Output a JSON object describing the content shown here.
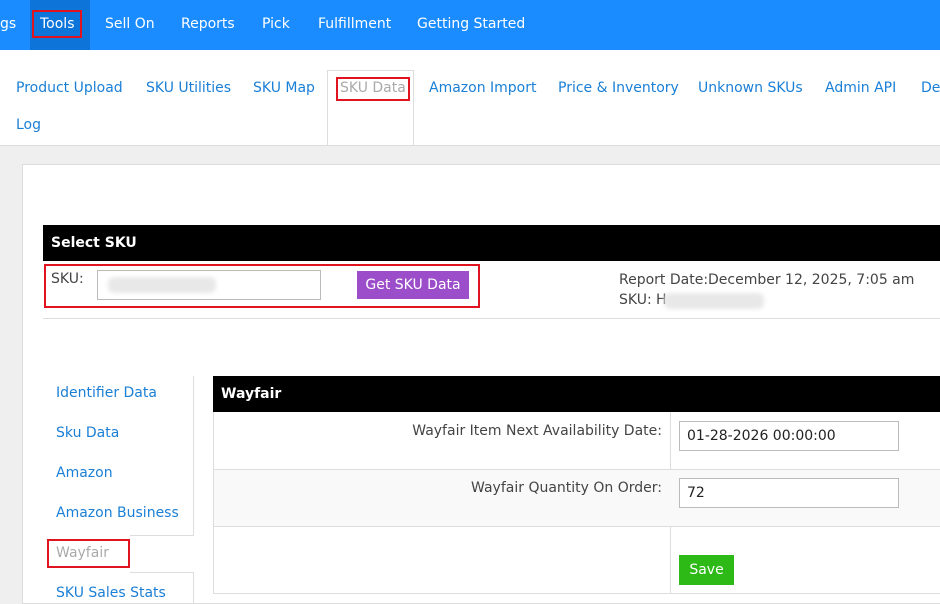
{
  "topnav": {
    "items": [
      {
        "label": "gs"
      },
      {
        "label": "Tools"
      },
      {
        "label": "Sell On"
      },
      {
        "label": "Reports"
      },
      {
        "label": "Pick"
      },
      {
        "label": "Fulfillment"
      },
      {
        "label": "Getting Started"
      }
    ]
  },
  "subtabs": {
    "items": [
      {
        "label": "Product Upload"
      },
      {
        "label": "SKU Utilities"
      },
      {
        "label": "SKU Map"
      },
      {
        "label": "SKU Data"
      },
      {
        "label": "Amazon Import"
      },
      {
        "label": "Price & Inventory"
      },
      {
        "label": "Unknown SKUs"
      },
      {
        "label": "Admin API"
      },
      {
        "label": "De"
      },
      {
        "label": "Log"
      }
    ]
  },
  "select_sku": {
    "title": "Select SKU",
    "sku_label": "SKU:",
    "sku_value": "",
    "button_label": "Get SKU Data",
    "report_date_label": "Report Date:",
    "report_date_value": "December 12, 2025, 7:05 am",
    "report_sku_label": "SKU:",
    "report_sku_value": "H"
  },
  "sidebar": {
    "items": [
      {
        "label": "Identifier Data"
      },
      {
        "label": "Sku Data"
      },
      {
        "label": "Amazon"
      },
      {
        "label": "Amazon Business"
      },
      {
        "label": "Wayfair"
      },
      {
        "label": "SKU Sales Stats"
      }
    ]
  },
  "wayfair": {
    "title": "Wayfair",
    "fields": [
      {
        "label": "Wayfair Item Next Availability Date:",
        "value": "01-28-2026 00:00:00"
      },
      {
        "label": "Wayfair Quantity On Order:",
        "value": "72"
      }
    ],
    "save_label": "Save"
  },
  "colors": {
    "nav_blue": "#1a8cff",
    "link_blue": "#1a7fd6",
    "highlight_red": "#e0141e",
    "purple": "#9b4dca",
    "green": "#2dba16"
  }
}
